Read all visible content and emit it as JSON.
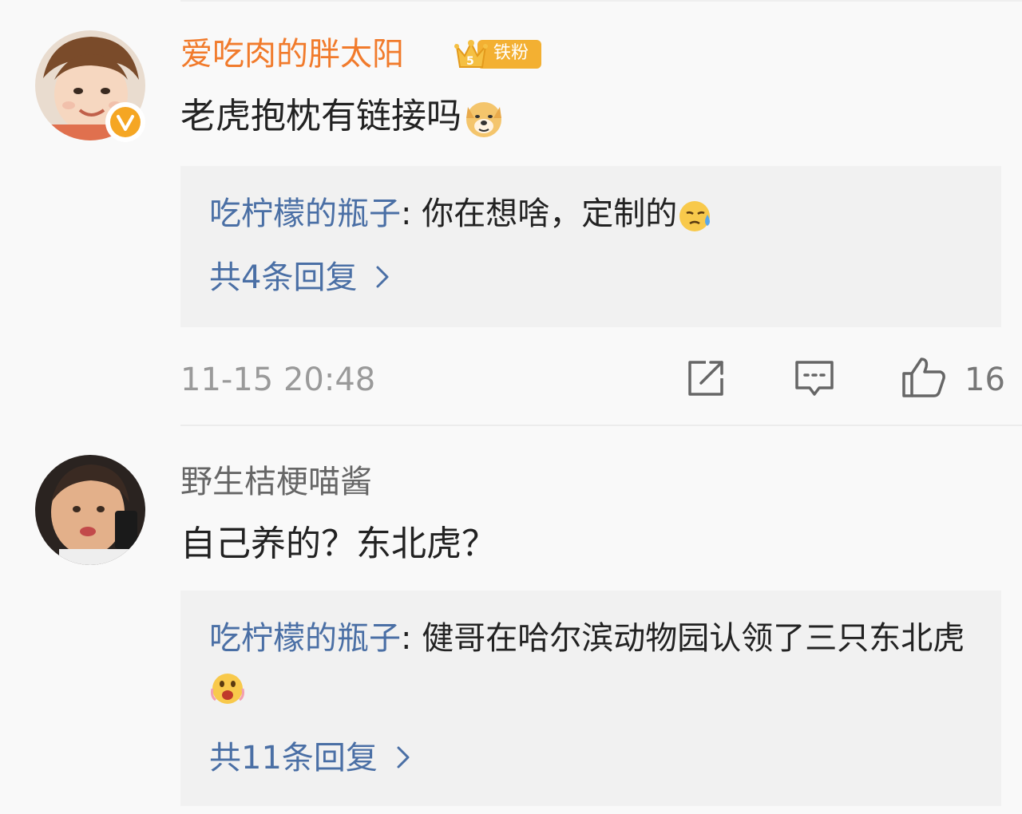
{
  "comments": [
    {
      "username": "爱吃肉的胖太阳",
      "fan_badge": "铁粉",
      "text": "老虎抱枕有链接吗",
      "emoji": "doge-icon",
      "reply": {
        "user": "吃柠檬的瓶子",
        "sep": ": ",
        "text": "你在想啥，定制的",
        "emoji": "sweat-cry-icon"
      },
      "reply_count_label": "共4条回复",
      "timestamp": "11-15 20:48",
      "like_count": "16"
    },
    {
      "username": "野生桔梗喵酱",
      "text": "自己养的？东北虎？",
      "reply": {
        "user": "吃柠檬的瓶子",
        "sep": ": ",
        "text": "健哥在哈尔滨动物园认领了三只东北虎",
        "emoji": "shocked-icon"
      },
      "reply_count_label": "共11条回复"
    }
  ],
  "colors": {
    "vip_username": "#f17b2c",
    "reply_user": "#4a6fa5",
    "background": "#f9f9f9",
    "reply_box": "#f1f1f1"
  }
}
